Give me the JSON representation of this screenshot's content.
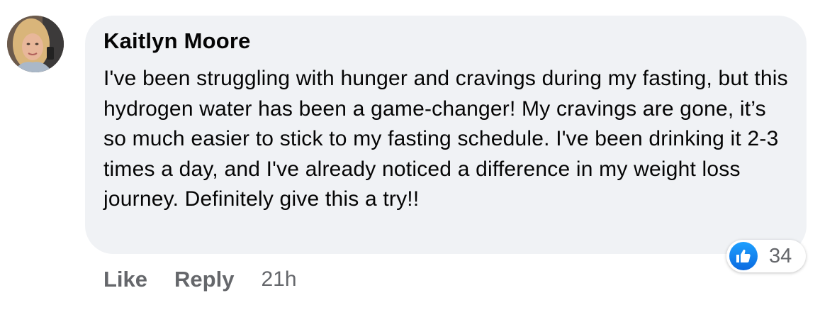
{
  "comment": {
    "author": "Kaitlyn Moore",
    "text": "I've been struggling with hunger and cravings during my fasting, but this hydrogen water has been a game-changer! My cravings are gone, it’s so much easier to stick to my fasting schedule. I've been drinking it 2-3 times a day, and I've already noticed a difference in my weight loss journey. Definitely give this a try!!",
    "reaction_count": "34",
    "reaction_icon": "thumbs-up-icon",
    "actions": {
      "like_label": "Like",
      "reply_label": "Reply"
    },
    "timestamp": "21h"
  },
  "colors": {
    "bubble": "#f0f2f5",
    "text": "#050505",
    "muted": "#65676b",
    "like_blue": "#0a6ae0"
  }
}
